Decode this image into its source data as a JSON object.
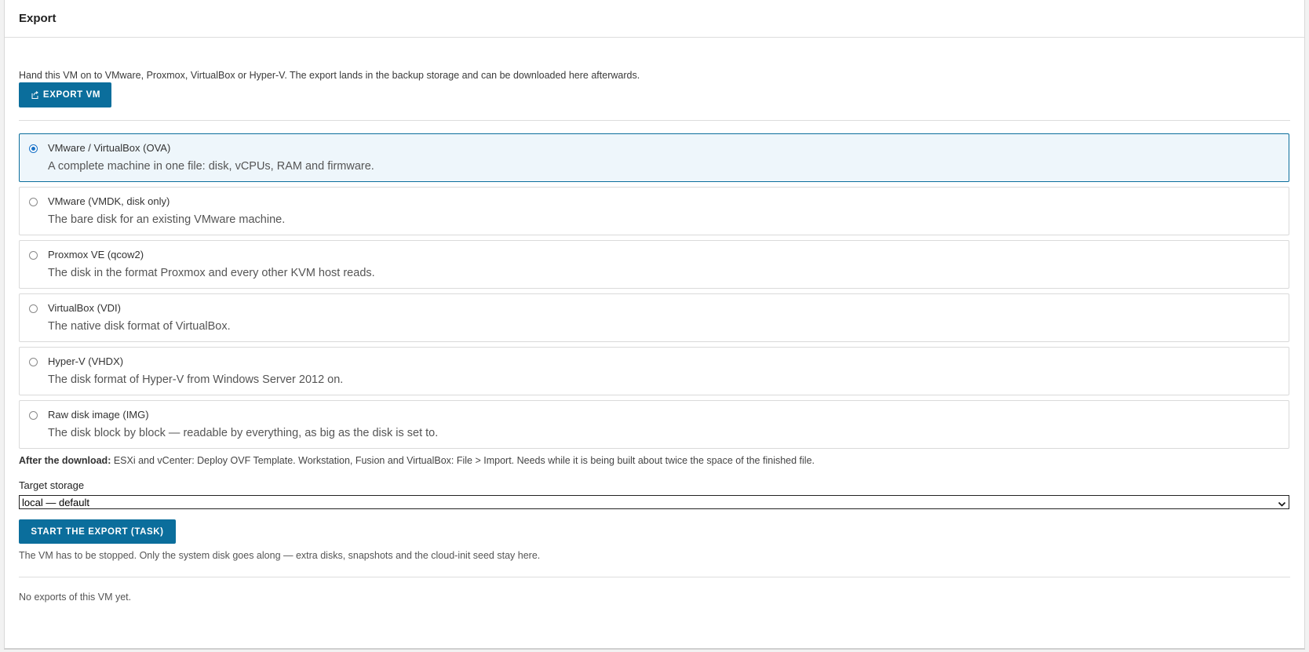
{
  "card": {
    "title": "Export"
  },
  "intro": "Hand this VM on to VMware, Proxmox, VirtualBox or Hyper-V. The export lands in the backup storage and can be downloaded here afterwards.",
  "export_button": {
    "label": "EXPORT VM",
    "icon": "export-icon"
  },
  "formats": [
    {
      "title": "VMware / VirtualBox (OVA)",
      "desc": "A complete machine in one file: disk, vCPUs, RAM and firmware.",
      "selected": true
    },
    {
      "title": "VMware (VMDK, disk only)",
      "desc": "The bare disk for an existing VMware machine.",
      "selected": false
    },
    {
      "title": "Proxmox VE (qcow2)",
      "desc": "The disk in the format Proxmox and every other KVM host reads.",
      "selected": false
    },
    {
      "title": "VirtualBox (VDI)",
      "desc": "The native disk format of VirtualBox.",
      "selected": false
    },
    {
      "title": "Hyper-V (VHDX)",
      "desc": "The disk format of Hyper-V from Windows Server 2012 on.",
      "selected": false
    },
    {
      "title": "Raw disk image (IMG)",
      "desc": "The disk block by block — readable by everything, as big as the disk is set to.",
      "selected": false
    }
  ],
  "after_download": {
    "label": "After the download:",
    "text": " ESXi and vCenter: Deploy OVF Template. Workstation, Fusion and VirtualBox: File > Import. Needs while it is being built about twice the space of the finished file."
  },
  "target_storage": {
    "label": "Target storage",
    "selected": "local — default"
  },
  "start_button": {
    "label": "START THE EXPORT (TASK)"
  },
  "hint": "The VM has to be stopped. Only the system disk goes along — extra disks, snapshots and the cloud-init seed stay here.",
  "empty_state": "No exports of this VM yet.",
  "colors": {
    "accent": "#0b6e9c",
    "selected_bg": "#eef6fb",
    "radio_on": "#1a73c8"
  }
}
